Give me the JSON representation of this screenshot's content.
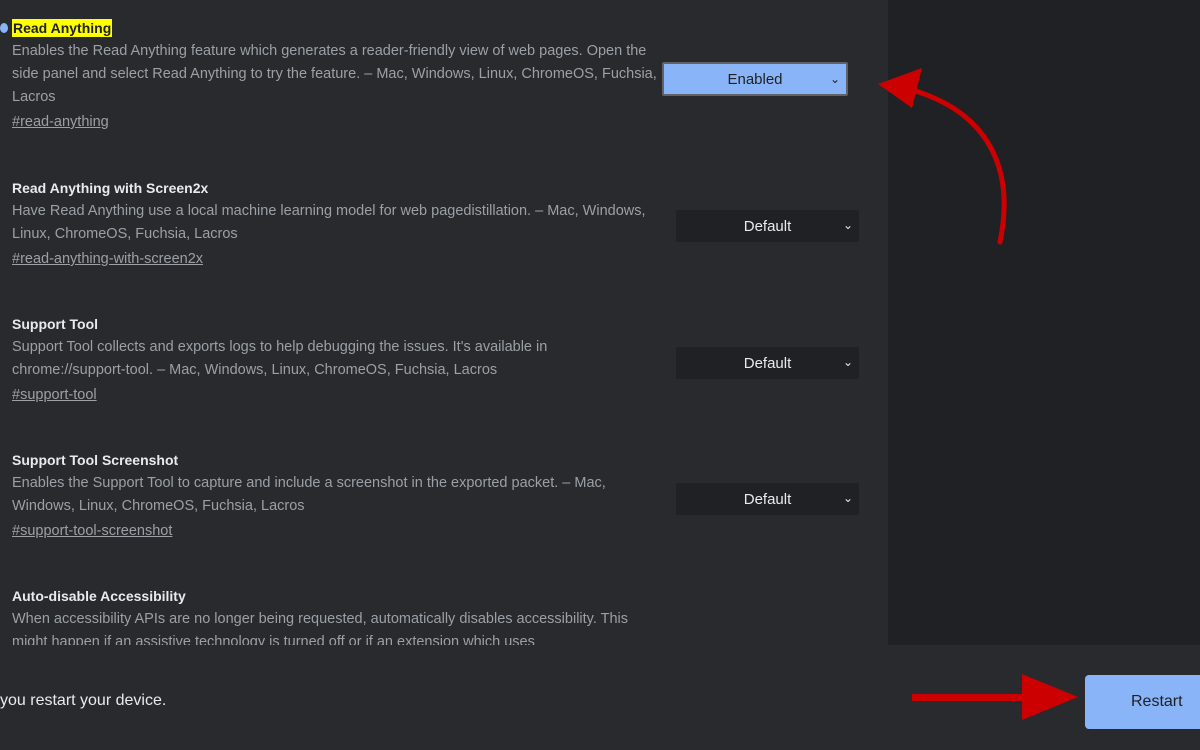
{
  "experiments": [
    {
      "title": "Read Anything",
      "highlighted": true,
      "description": "Enables the Read Anything feature which generates a reader-friendly view of web pages. Open the side panel and select Read Anything to try the feature. – Mac, Windows, Linux, ChromeOS, Fuchsia, Lacros",
      "link": "#read-anything",
      "value": "Enabled"
    },
    {
      "title": "Read Anything with Screen2x",
      "description": "Have Read Anything use a local machine learning model for web pagedistillation. – Mac, Windows, Linux, ChromeOS, Fuchsia, Lacros",
      "link": "#read-anything-with-screen2x",
      "value": "Default"
    },
    {
      "title": "Support Tool",
      "description": "Support Tool collects and exports logs to help debugging the issues. It's available in chrome://support-tool. – Mac, Windows, Linux, ChromeOS, Fuchsia, Lacros",
      "link": "#support-tool",
      "value": "Default"
    },
    {
      "title": "Support Tool Screenshot",
      "description": "Enables the Support Tool to capture and include a screenshot in the exported packet. – Mac, Windows, Linux, ChromeOS, Fuchsia, Lacros",
      "link": "#support-tool-screenshot",
      "value": "Default"
    },
    {
      "title": "Auto-disable Accessibility",
      "description": "When accessibility APIs are no longer being requested, automatically disables accessibility. This might happen if an assistive technology is turned off or if an extension which uses"
    }
  ],
  "footer": {
    "message": "you restart your device.",
    "restart_label": "Restart"
  },
  "colors": {
    "accent": "#8ab4f8",
    "highlight": "#ffff00",
    "annotation_arrow": "#cc0000"
  },
  "icons": {
    "dropdown": "chevron-down-icon",
    "annotation": "arrow-icon"
  }
}
